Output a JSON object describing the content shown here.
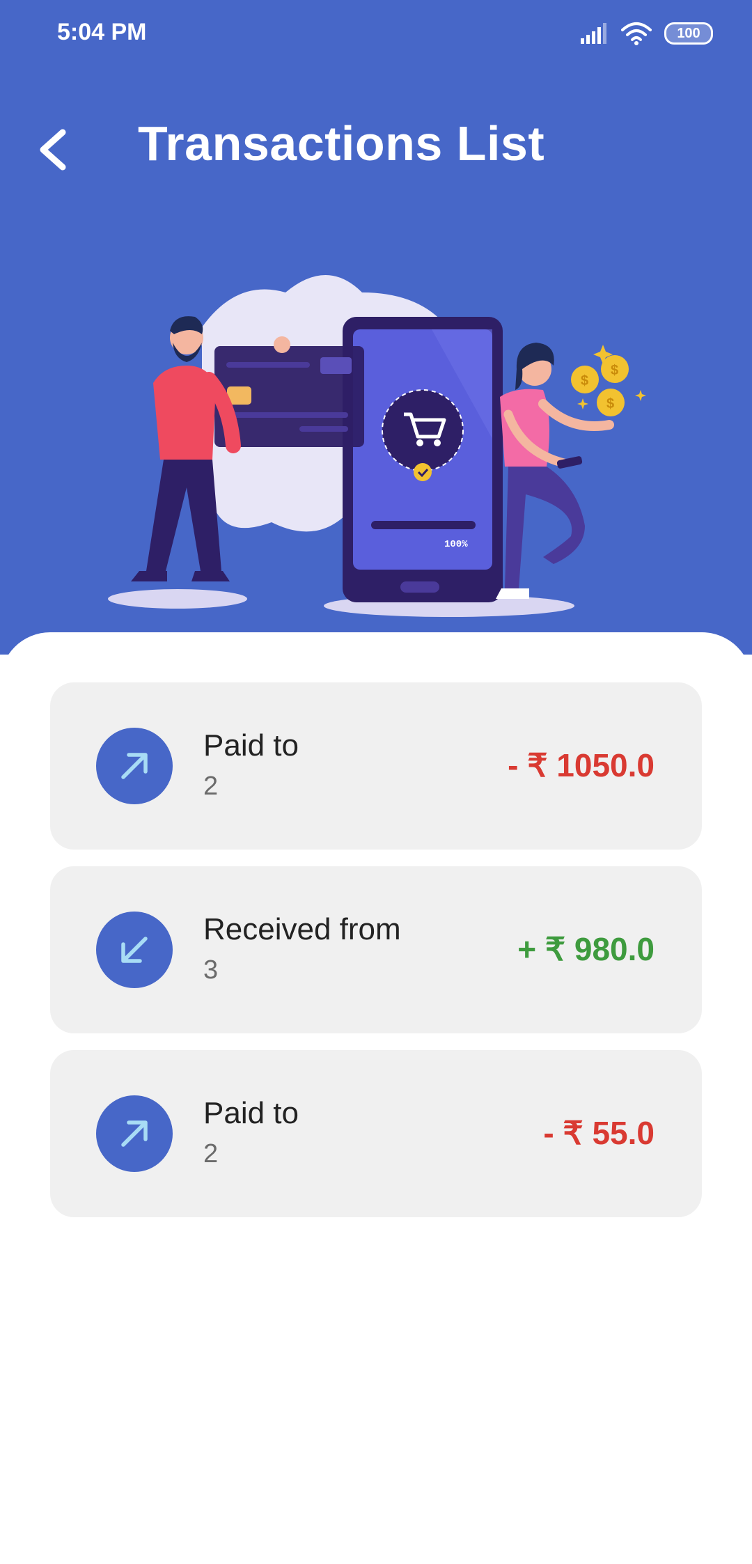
{
  "status_bar": {
    "time": "5:04 PM",
    "battery": "100",
    "icons": [
      "signal-icon",
      "wifi-icon",
      "battery-icon"
    ]
  },
  "header": {
    "title": "Transactions List",
    "back_icon": "chevron-left-icon",
    "background": "#4767c8"
  },
  "illustration": {
    "progress_text": "100%"
  },
  "transactions": [
    {
      "label": "Paid to",
      "sub": "2",
      "amount": "- ₹ 1050.0",
      "direction": "out",
      "icon": "arrow-up-right-icon",
      "color": "#d93a32"
    },
    {
      "label": "Received from",
      "sub": "3",
      "amount": "+ ₹ 980.0",
      "direction": "in",
      "icon": "arrow-down-left-icon",
      "color": "#3e9b3e"
    },
    {
      "label": "Paid to",
      "sub": "2",
      "amount": "- ₹ 55.0",
      "direction": "out",
      "icon": "arrow-up-right-icon",
      "color": "#d93a32"
    }
  ]
}
